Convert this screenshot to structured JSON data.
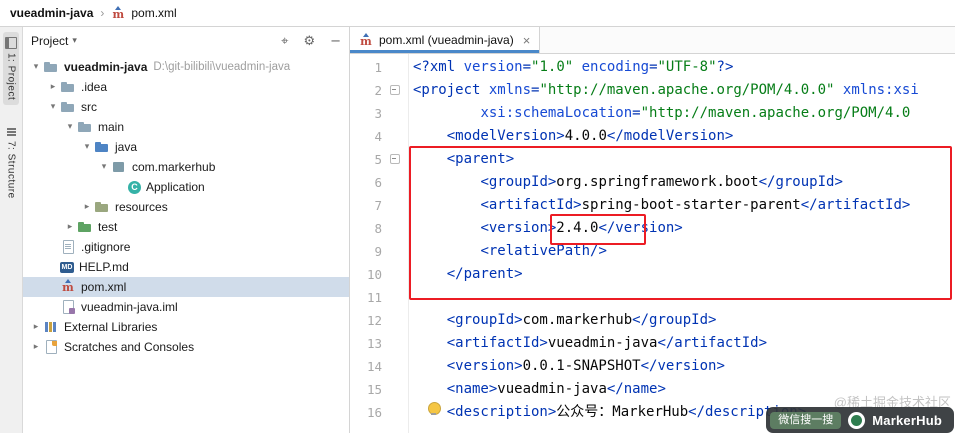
{
  "breadcrumb": {
    "project": "vueadmin-java",
    "file": "pom.xml"
  },
  "tool_stripe": {
    "project_tab": "1: Project",
    "structure_tab": "7: Structure"
  },
  "project_panel": {
    "title": "Project",
    "tree": [
      {
        "label": "vueadmin-java",
        "suffix": "D:\\git-bilibili\\vueadmin-java",
        "icon": "folder",
        "level": 0,
        "arrow": "expanded",
        "bold": true
      },
      {
        "label": ".idea",
        "icon": "folder",
        "level": 1,
        "arrow": "collapsed"
      },
      {
        "label": "src",
        "icon": "folder",
        "level": 1,
        "arrow": "expanded"
      },
      {
        "label": "main",
        "icon": "folder",
        "level": 2,
        "arrow": "expanded"
      },
      {
        "label": "java",
        "icon": "folder-src",
        "level": 3,
        "arrow": "expanded"
      },
      {
        "label": "com.markerhub",
        "icon": "package",
        "level": 4,
        "arrow": "expanded"
      },
      {
        "label": "Application",
        "icon": "class",
        "icon_text": "C",
        "level": 5,
        "arrow": "none"
      },
      {
        "label": "resources",
        "icon": "folder-res",
        "level": 3,
        "arrow": "collapsed"
      },
      {
        "label": "test",
        "icon": "folder-test",
        "level": 2,
        "arrow": "collapsed"
      },
      {
        "label": ".gitignore",
        "icon": "file-git",
        "level": 1,
        "arrow": "none"
      },
      {
        "label": "HELP.md",
        "icon": "file-md",
        "icon_text": "MD",
        "level": 1,
        "arrow": "none"
      },
      {
        "label": "pom.xml",
        "icon": "file-maven",
        "icon_text": "m",
        "level": 1,
        "arrow": "none",
        "selected": true
      },
      {
        "label": "vueadmin-java.iml",
        "icon": "file-iml",
        "level": 1,
        "arrow": "none"
      },
      {
        "label": "External Libraries",
        "icon": "library",
        "level": 0,
        "arrow": "collapsed"
      },
      {
        "label": "Scratches and Consoles",
        "icon": "scratch",
        "level": 0,
        "arrow": "collapsed"
      }
    ]
  },
  "editor": {
    "tab": "pom.xml (vueadmin-java)",
    "fold_lines": [
      2,
      5
    ],
    "lines": [
      {
        "n": 1,
        "tokens": [
          [
            "<?xml ",
            "tag"
          ],
          [
            "version",
            "attr"
          ],
          [
            "=",
            "tag"
          ],
          [
            "\"1.0\"",
            "str"
          ],
          [
            " ",
            "plain"
          ],
          [
            "encoding",
            "attr"
          ],
          [
            "=",
            "tag"
          ],
          [
            "\"UTF-8\"",
            "str"
          ],
          [
            "?>",
            "tag"
          ]
        ]
      },
      {
        "n": 2,
        "tokens": [
          [
            "<project ",
            "tag"
          ],
          [
            "xmlns",
            "attr"
          ],
          [
            "=",
            "tag"
          ],
          [
            "\"http://maven.apache.org/POM/4.0.0\"",
            "str"
          ],
          [
            " ",
            "plain"
          ],
          [
            "xmlns:xsi",
            "attr"
          ]
        ]
      },
      {
        "n": 3,
        "tokens": [
          [
            "        ",
            "plain"
          ],
          [
            "xsi:schemaLocation",
            "attr"
          ],
          [
            "=",
            "tag"
          ],
          [
            "\"http://maven.apache.org/POM/4.0",
            "str"
          ]
        ]
      },
      {
        "n": 4,
        "tokens": [
          [
            "    ",
            "plain"
          ],
          [
            "<modelVersion>",
            "tag"
          ],
          [
            "4.0.0",
            "plain"
          ],
          [
            "</modelVersion>",
            "tag"
          ]
        ]
      },
      {
        "n": 5,
        "tokens": [
          [
            "    ",
            "plain"
          ],
          [
            "<parent>",
            "tag"
          ]
        ]
      },
      {
        "n": 6,
        "tokens": [
          [
            "        ",
            "plain"
          ],
          [
            "<groupId>",
            "tag"
          ],
          [
            "org.springframework.boot",
            "plain"
          ],
          [
            "</groupId>",
            "tag"
          ]
        ]
      },
      {
        "n": 7,
        "tokens": [
          [
            "        ",
            "plain"
          ],
          [
            "<artifactId>",
            "tag"
          ],
          [
            "spring-boot-starter-parent",
            "plain"
          ],
          [
            "</artifactId>",
            "tag"
          ]
        ]
      },
      {
        "n": 8,
        "tokens": [
          [
            "        ",
            "plain"
          ],
          [
            "<version>",
            "tag"
          ],
          [
            "2.4.0",
            "plain"
          ],
          [
            "</version>",
            "tag"
          ]
        ]
      },
      {
        "n": 9,
        "tokens": [
          [
            "        ",
            "plain"
          ],
          [
            "<relativePath/>",
            "tag"
          ]
        ]
      },
      {
        "n": 10,
        "tokens": [
          [
            "    ",
            "plain"
          ],
          [
            "</parent>",
            "tag"
          ]
        ]
      },
      {
        "n": 11,
        "tokens": []
      },
      {
        "n": 12,
        "tokens": [
          [
            "    ",
            "plain"
          ],
          [
            "<groupId>",
            "tag"
          ],
          [
            "com.markerhub",
            "plain"
          ],
          [
            "</groupId>",
            "tag"
          ]
        ]
      },
      {
        "n": 13,
        "tokens": [
          [
            "    ",
            "plain"
          ],
          [
            "<artifactId>",
            "tag"
          ],
          [
            "vueadmin-java",
            "plain"
          ],
          [
            "</artifactId>",
            "tag"
          ]
        ]
      },
      {
        "n": 14,
        "tokens": [
          [
            "    ",
            "plain"
          ],
          [
            "<version>",
            "tag"
          ],
          [
            "0.0.1-SNAPSHOT",
            "plain"
          ],
          [
            "</version>",
            "tag"
          ]
        ]
      },
      {
        "n": 15,
        "tokens": [
          [
            "    ",
            "plain"
          ],
          [
            "<name>",
            "tag"
          ],
          [
            "vueadmin-java",
            "plain"
          ],
          [
            "</name>",
            "tag"
          ]
        ]
      },
      {
        "n": 16,
        "tokens": [
          [
            "    ",
            "plain"
          ],
          [
            "<description>",
            "tag"
          ],
          [
            "公众号：MarkerHub",
            "plain"
          ],
          [
            "</description>",
            "tag"
          ]
        ]
      }
    ]
  },
  "icons": {
    "maven": "m",
    "gear": "⚙",
    "locate": "⌖",
    "hide": "−",
    "caret": "▾",
    "close": "×",
    "separator": "›",
    "expanded": "▾",
    "collapsed": "▸"
  },
  "colors": {
    "annotation": "#ec1c24",
    "xml_tag": "#0033b3",
    "xml_attribute": "#174ad4",
    "xml_string": "#067d17",
    "tree_selection": "#d0dcea"
  },
  "watermark": {
    "credit": "@稀土掘金技术社区",
    "badge_left": "微信搜一搜",
    "badge_right": "MarkerHub"
  }
}
